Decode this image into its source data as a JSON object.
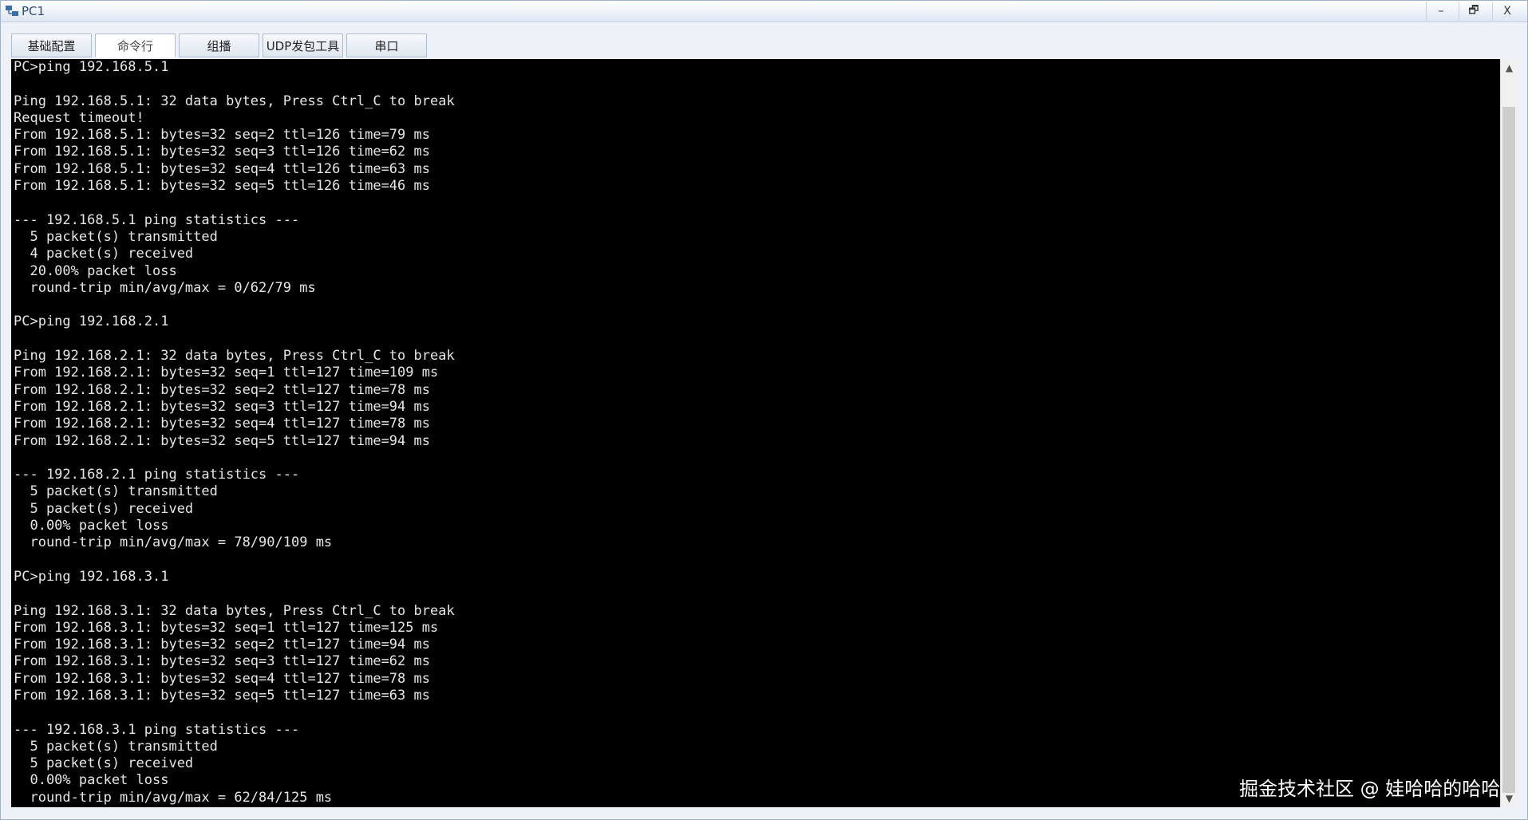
{
  "window": {
    "title": "PC1",
    "minimize": "–",
    "maximize": "🗗",
    "close": "X"
  },
  "tabs": [
    {
      "label": "基础配置",
      "active": false
    },
    {
      "label": "命令行",
      "active": true
    },
    {
      "label": "组播",
      "active": false
    },
    {
      "label": "UDP发包工具",
      "active": false
    },
    {
      "label": "串口",
      "active": false
    }
  ],
  "terminal": {
    "lines": [
      "PC>ping 192.168.5.1",
      "",
      "Ping 192.168.5.1: 32 data bytes, Press Ctrl_C to break",
      "Request timeout!",
      "From 192.168.5.1: bytes=32 seq=2 ttl=126 time=79 ms",
      "From 192.168.5.1: bytes=32 seq=3 ttl=126 time=62 ms",
      "From 192.168.5.1: bytes=32 seq=4 ttl=126 time=63 ms",
      "From 192.168.5.1: bytes=32 seq=5 ttl=126 time=46 ms",
      "",
      "--- 192.168.5.1 ping statistics ---",
      "  5 packet(s) transmitted",
      "  4 packet(s) received",
      "  20.00% packet loss",
      "  round-trip min/avg/max = 0/62/79 ms",
      "",
      "PC>ping 192.168.2.1",
      "",
      "Ping 192.168.2.1: 32 data bytes, Press Ctrl_C to break",
      "From 192.168.2.1: bytes=32 seq=1 ttl=127 time=109 ms",
      "From 192.168.2.1: bytes=32 seq=2 ttl=127 time=78 ms",
      "From 192.168.2.1: bytes=32 seq=3 ttl=127 time=94 ms",
      "From 192.168.2.1: bytes=32 seq=4 ttl=127 time=78 ms",
      "From 192.168.2.1: bytes=32 seq=5 ttl=127 time=94 ms",
      "",
      "--- 192.168.2.1 ping statistics ---",
      "  5 packet(s) transmitted",
      "  5 packet(s) received",
      "  0.00% packet loss",
      "  round-trip min/avg/max = 78/90/109 ms",
      "",
      "PC>ping 192.168.3.1",
      "",
      "Ping 192.168.3.1: 32 data bytes, Press Ctrl_C to break",
      "From 192.168.3.1: bytes=32 seq=1 ttl=127 time=125 ms",
      "From 192.168.3.1: bytes=32 seq=2 ttl=127 time=94 ms",
      "From 192.168.3.1: bytes=32 seq=3 ttl=127 time=62 ms",
      "From 192.168.3.1: bytes=32 seq=4 ttl=127 time=78 ms",
      "From 192.168.3.1: bytes=32 seq=5 ttl=127 time=63 ms",
      "",
      "--- 192.168.3.1 ping statistics ---",
      "  5 packet(s) transmitted",
      "  5 packet(s) received",
      "  0.00% packet loss",
      "  round-trip min/avg/max = 62/84/125 ms"
    ]
  },
  "watermark": "掘金技术社区 @ 娃哈哈的哈哈",
  "colors": {
    "terminal_bg": "#000000",
    "terminal_fg": "#e6e6e6",
    "title_text": "#2a4e7e"
  },
  "icons": {
    "app": "network-pc-icon",
    "scroll_up": "chevron-up-icon",
    "scroll_down": "chevron-down-icon"
  }
}
